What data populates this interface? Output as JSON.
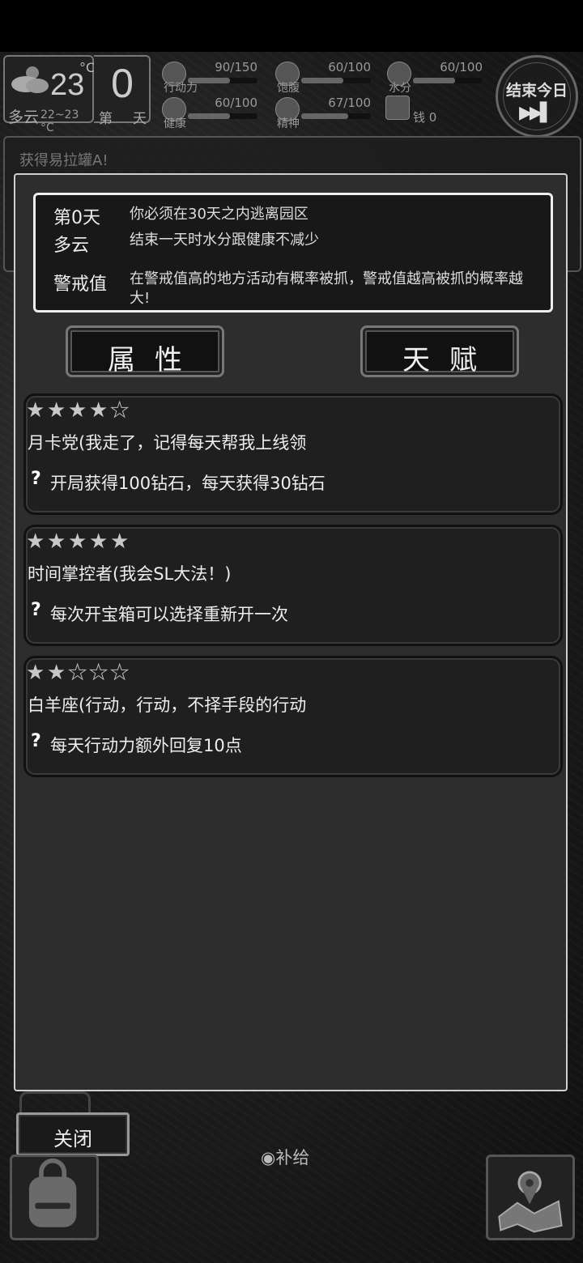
{
  "hud": {
    "weather": {
      "temp": "23",
      "unit": "°C",
      "condition": "多云",
      "range": "22~23 °C",
      "icon": "cloud-sun-icon"
    },
    "day": {
      "number": "0",
      "label_a": "第",
      "label_b": "天"
    },
    "stats": [
      {
        "id": "action",
        "label": "行动力",
        "value": "90/150",
        "fraction": 0.6,
        "icon": "footprint-icon"
      },
      {
        "id": "satiety",
        "label": "饱腹",
        "value": "60/100",
        "fraction": 0.6,
        "icon": "food-icon"
      },
      {
        "id": "water",
        "label": "水分",
        "value": "60/100",
        "fraction": 0.6,
        "icon": "water-drop-icon"
      },
      {
        "id": "health",
        "label": "健康",
        "value": "60/100",
        "fraction": 0.6,
        "icon": "medkit-icon"
      },
      {
        "id": "spirit",
        "label": "精神",
        "value": "67/100",
        "fraction": 0.67,
        "icon": "brain-icon"
      }
    ],
    "money": {
      "label": "钱 0",
      "icon": "money-icon"
    },
    "end_day": {
      "label": "结束今日",
      "icon": "fast-forward-icon"
    }
  },
  "background_panel": {
    "text": "获得易拉罐A!"
  },
  "dialog": {
    "info": {
      "day_key": "第0天",
      "day_value": "你必须在30天之内逃离园区",
      "weather_key": "多云",
      "weather_value": "结束一天时水分跟健康不减少",
      "alert_key": "警戒值",
      "alert_value": "在警戒值高的地方活动有概率被抓，警戒值越高被抓的概率越大!"
    },
    "tabs": {
      "attributes": "属性",
      "talents": "天赋"
    },
    "talents": [
      {
        "stars": 4,
        "max": 5,
        "title": "月卡党(我走了，记得每天帮我上线领",
        "desc": "开局获得100钻石，每天获得30钻石"
      },
      {
        "stars": 5,
        "max": 5,
        "title": "时间掌控者(我会SL大法！)",
        "desc": "每次开宝箱可以选择重新开一次"
      },
      {
        "stars": 2,
        "max": 5,
        "title": "白羊座(行动，行动，不择手段的行动",
        "desc": "每天行动力额外回复10点"
      }
    ]
  },
  "bottom": {
    "close_label": "关闭",
    "supply_label": "◉补给",
    "bag_icon": "backpack-icon",
    "map_icon": "map-icon"
  }
}
